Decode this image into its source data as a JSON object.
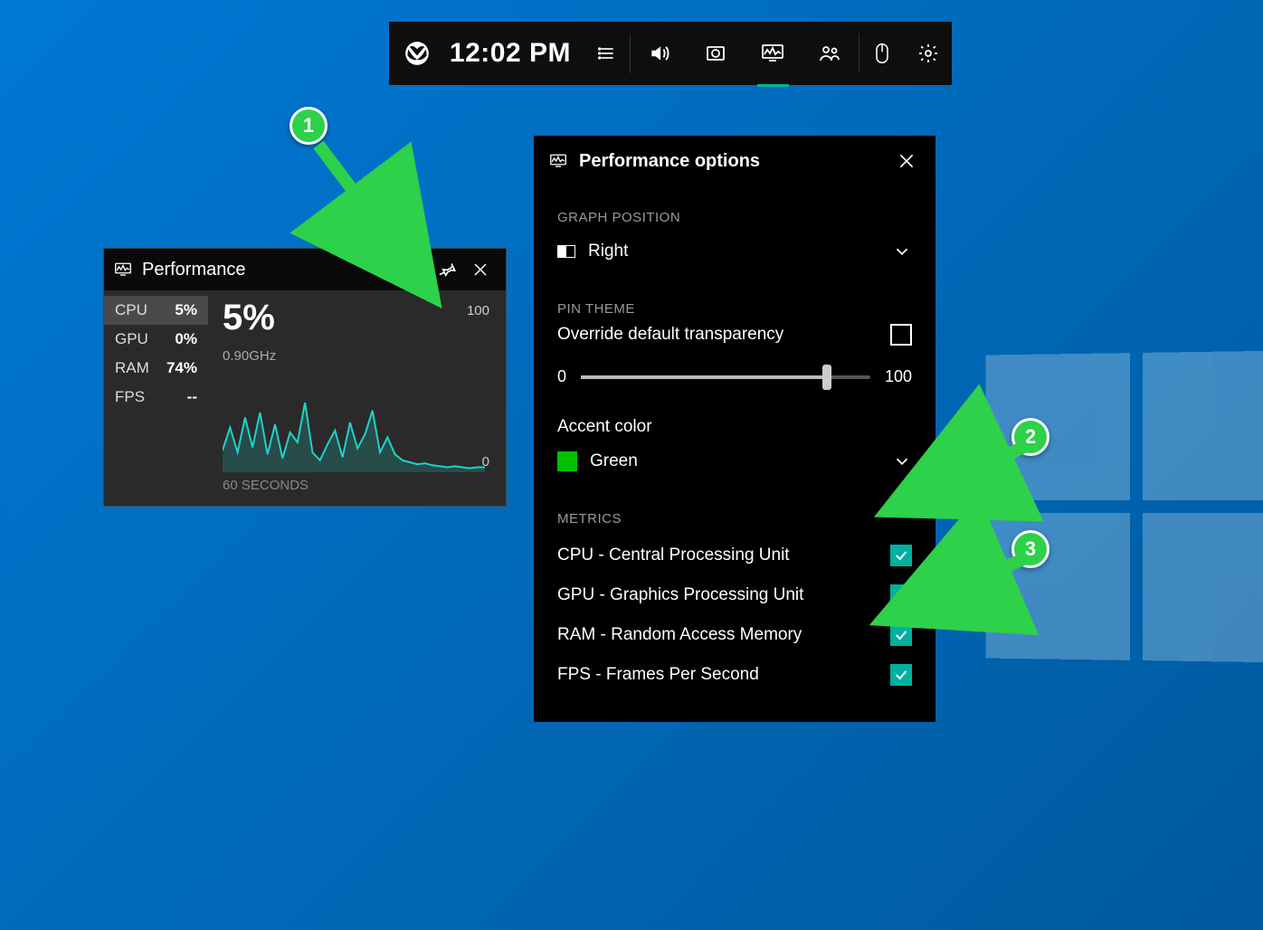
{
  "topbar": {
    "time": "12:02 PM"
  },
  "perf": {
    "title": "Performance",
    "metrics": [
      {
        "label": "CPU",
        "value": "5%",
        "active": true
      },
      {
        "label": "GPU",
        "value": "0%",
        "active": false
      },
      {
        "label": "RAM",
        "value": "74%",
        "active": false
      },
      {
        "label": "FPS",
        "value": "--",
        "active": false
      }
    ],
    "big_value": "5%",
    "clock": "0.90GHz",
    "y_top": "100",
    "y_bottom": "0",
    "x_label": "60 SECONDS"
  },
  "options": {
    "title": "Performance options",
    "graph_position": {
      "label": "GRAPH POSITION",
      "value": "Right"
    },
    "pin_theme_label": "PIN THEME",
    "override_label": "Override default transparency",
    "override_checked": false,
    "slider": {
      "min": "0",
      "max": "100",
      "value": 85
    },
    "accent": {
      "label": "Accent color",
      "value": "Green",
      "color": "#00c000"
    },
    "metrics_label": "METRICS",
    "metrics": [
      {
        "label": "CPU - Central Processing Unit",
        "checked": true
      },
      {
        "label": "GPU - Graphics Processing Unit",
        "checked": true
      },
      {
        "label": "RAM - Random Access Memory",
        "checked": true
      },
      {
        "label": "FPS - Frames Per Second",
        "checked": true
      }
    ]
  },
  "callouts": {
    "c1": "1",
    "c2": "2",
    "c3": "3"
  },
  "chart_data": {
    "type": "line",
    "title": "CPU usage",
    "xlabel": "60 SECONDS",
    "ylabel": "%",
    "ylim": [
      0,
      100
    ],
    "x_range_seconds": 60,
    "values": [
      22,
      45,
      20,
      55,
      25,
      60,
      18,
      48,
      14,
      40,
      30,
      70,
      20,
      12,
      28,
      42,
      15,
      50,
      24,
      38,
      62,
      20,
      35,
      18,
      12,
      10,
      8,
      9,
      7,
      6,
      5,
      6,
      5,
      4,
      5,
      5
    ]
  }
}
